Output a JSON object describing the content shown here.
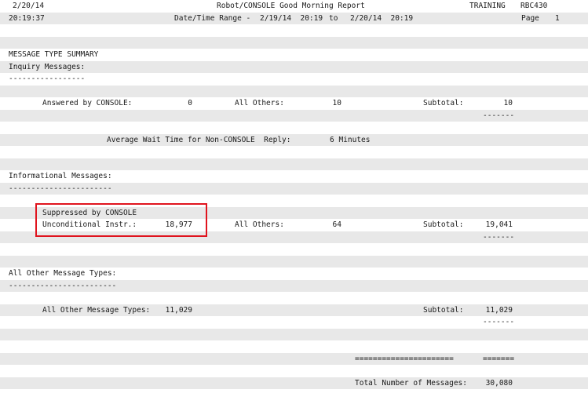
{
  "header": {
    "date": "2/20/14",
    "title": "Robot/CONSOLE Good Morning Report",
    "env": "TRAINING",
    "report_id": "RBC430",
    "time": "20:19:37",
    "range_label": "Date/Time Range -",
    "range_from": "2/19/14  20:19",
    "range_to_word": "to",
    "range_to": "2/20/14  20:19",
    "page_label": "Page",
    "page_num": "1"
  },
  "summary": {
    "heading": "MESSAGE TYPE SUMMARY",
    "inquiry": {
      "heading": "Inquiry Messages:",
      "underline": "-----------------",
      "answered_label": "Answered by CONSOLE:",
      "answered_value": "0",
      "others_label": "All Others:",
      "others_value": "10",
      "subtotal_label": "Subtotal:",
      "subtotal_value": "10",
      "subtotal_rule": "-------",
      "avg_label": "Average Wait Time for Non-CONSOLE  Reply:",
      "avg_value": "6 Minutes"
    },
    "informational": {
      "heading": "Informational Messages:",
      "underline": "-----------------------",
      "suppressed_label": "Suppressed by CONSOLE",
      "uncond_label": "Unconditional Instr.:",
      "uncond_value": "18,977",
      "others_label": "All Others:",
      "others_value": "64",
      "subtotal_label": "Subtotal:",
      "subtotal_value": "19,041",
      "subtotal_rule": "-------"
    },
    "other": {
      "heading": "All Other Message Types:",
      "underline": "------------------------",
      "label": "All Other Message Types:",
      "value": "11,029",
      "subtotal_label": "Subtotal:",
      "subtotal_value": "11,029",
      "subtotal_rule": "-------"
    },
    "total": {
      "rule_long": "======================",
      "rule_short": "=======",
      "label": "Total Number of Messages:",
      "value": "30,080"
    }
  }
}
